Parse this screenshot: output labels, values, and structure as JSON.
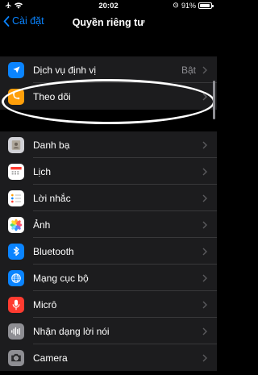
{
  "status_bar": {
    "time": "20:02",
    "battery_percent": "91%",
    "battery_level": 0.91
  },
  "nav": {
    "back_label": "Cài đặt",
    "title": "Quyền riêng tư"
  },
  "group1": [
    {
      "id": "location",
      "label": "Dịch vụ định vị",
      "value": "Bật",
      "icon": "location-arrow-icon",
      "color": "#0a84ff"
    },
    {
      "id": "tracking",
      "label": "Theo dõi",
      "value": "",
      "icon": "tracking-icon",
      "color": "#ff9f0a"
    }
  ],
  "group2": [
    {
      "id": "contacts",
      "label": "Danh bạ",
      "icon": "contacts-icon",
      "color": "#d1d1d6"
    },
    {
      "id": "calendar",
      "label": "Lịch",
      "icon": "calendar-icon",
      "color": "#ffffff"
    },
    {
      "id": "reminders",
      "label": "Lời nhắc",
      "icon": "reminders-icon",
      "color": "#ffffff"
    },
    {
      "id": "photos",
      "label": "Ảnh",
      "icon": "photos-icon",
      "color": "#ffffff"
    },
    {
      "id": "bluetooth",
      "label": "Bluetooth",
      "icon": "bluetooth-icon",
      "color": "#0a84ff"
    },
    {
      "id": "local-network",
      "label": "Mạng cục bộ",
      "icon": "globe-icon",
      "color": "#0a84ff"
    },
    {
      "id": "microphone",
      "label": "Micrô",
      "icon": "microphone-icon",
      "color": "#ff3b30"
    },
    {
      "id": "speech",
      "label": "Nhận dạng lời nói",
      "icon": "waveform-icon",
      "color": "#8e8e93"
    },
    {
      "id": "camera",
      "label": "Camera",
      "icon": "camera-icon",
      "color": "#8e8e93"
    }
  ]
}
